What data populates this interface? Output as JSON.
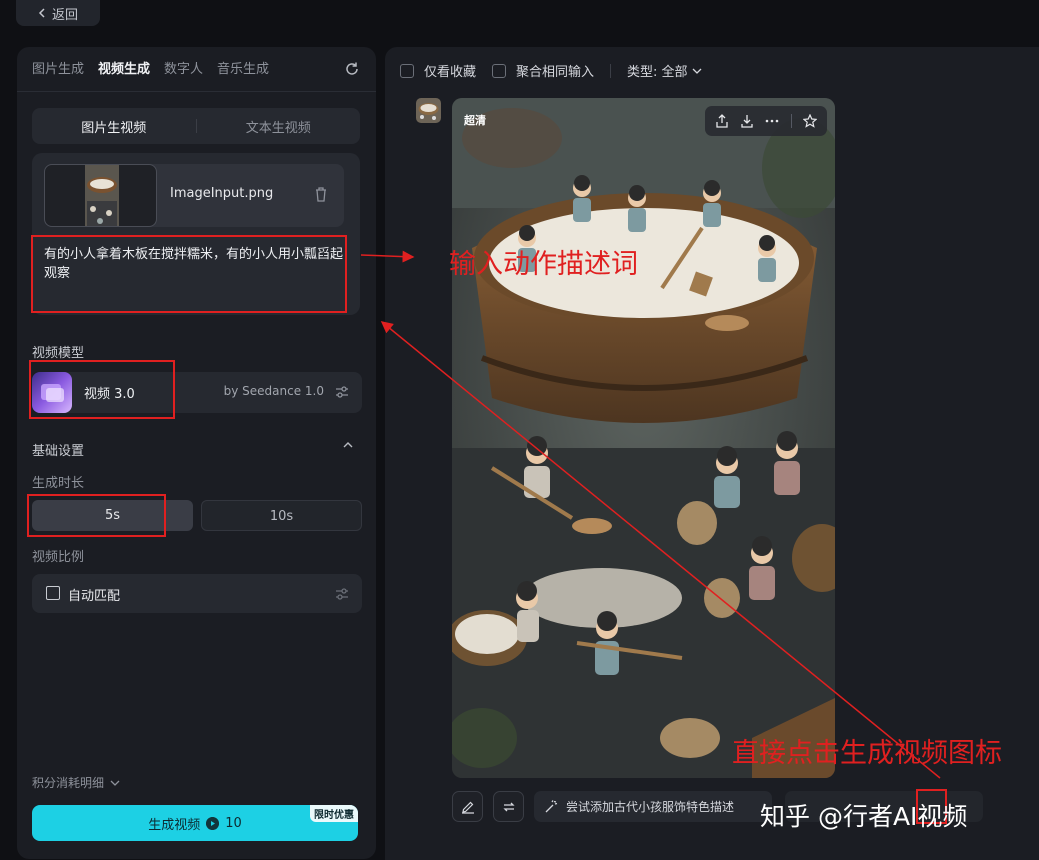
{
  "nav": {
    "back_label": "返回"
  },
  "left": {
    "tabs": [
      "图片生成",
      "视频生成",
      "数字人",
      "音乐生成"
    ],
    "active_tab": 1,
    "sub_tabs": [
      "图片生视频",
      "文本生视频"
    ],
    "active_sub_tab": 0,
    "file_name": "ImageInput.png",
    "prompt": "有的小人拿着木板在搅拌糯米，有的小人用小瓢舀起观察",
    "model_section_label": "视频模型",
    "model_name": "视频 3.0",
    "model_by": "by Seedance 1.0",
    "basic_settings_label": "基础设置",
    "duration_label": "生成时长",
    "duration_options": [
      "5s",
      "10s"
    ],
    "duration_selected": "5s",
    "ratio_label": "视频比例",
    "ratio_value": "自动匹配",
    "points_detail": "积分消耗明细",
    "generate_label": "生成视频",
    "generate_cost": "10",
    "promo_badge": "限时优惠"
  },
  "right": {
    "filters": {
      "favorites_only": "仅看收藏",
      "merge_same_input": "聚合相同输入",
      "type_label": "类型: 全部"
    },
    "card": {
      "hd_badge": "超清"
    },
    "suggestion": "尝试添加古代小孩服饰特色描述"
  },
  "annotations": {
    "input_hint": "输入动作描述词",
    "generate_hint": "直接点击生成视频图标"
  },
  "watermark": "知乎 @行者AI视频",
  "colors": {
    "accent": "#1dd0e4",
    "annotation": "#e02020",
    "background": "#0f1014",
    "panel": "#1b1d23"
  }
}
